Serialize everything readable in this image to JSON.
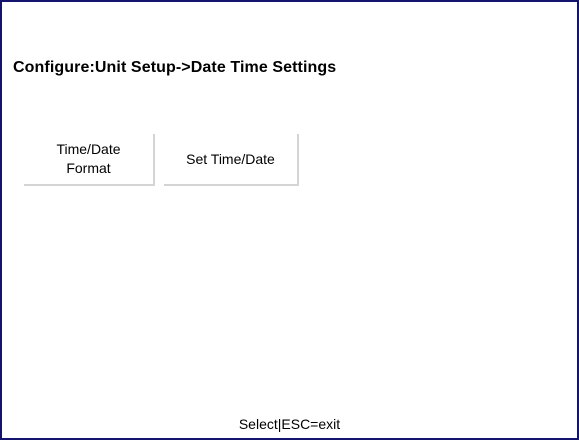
{
  "header": {
    "title": "Configure:Unit Setup->Date Time Settings"
  },
  "soft_keys": [
    {
      "line1": "Time/Date",
      "line2": "Format"
    },
    {
      "line1": "Set Time/Date"
    }
  ],
  "status_bar": {
    "text": "Select|ESC=exit"
  },
  "colors": {
    "frame": "#14146e",
    "background": "#ffffff",
    "key_shadow": "#d4d4d4"
  }
}
